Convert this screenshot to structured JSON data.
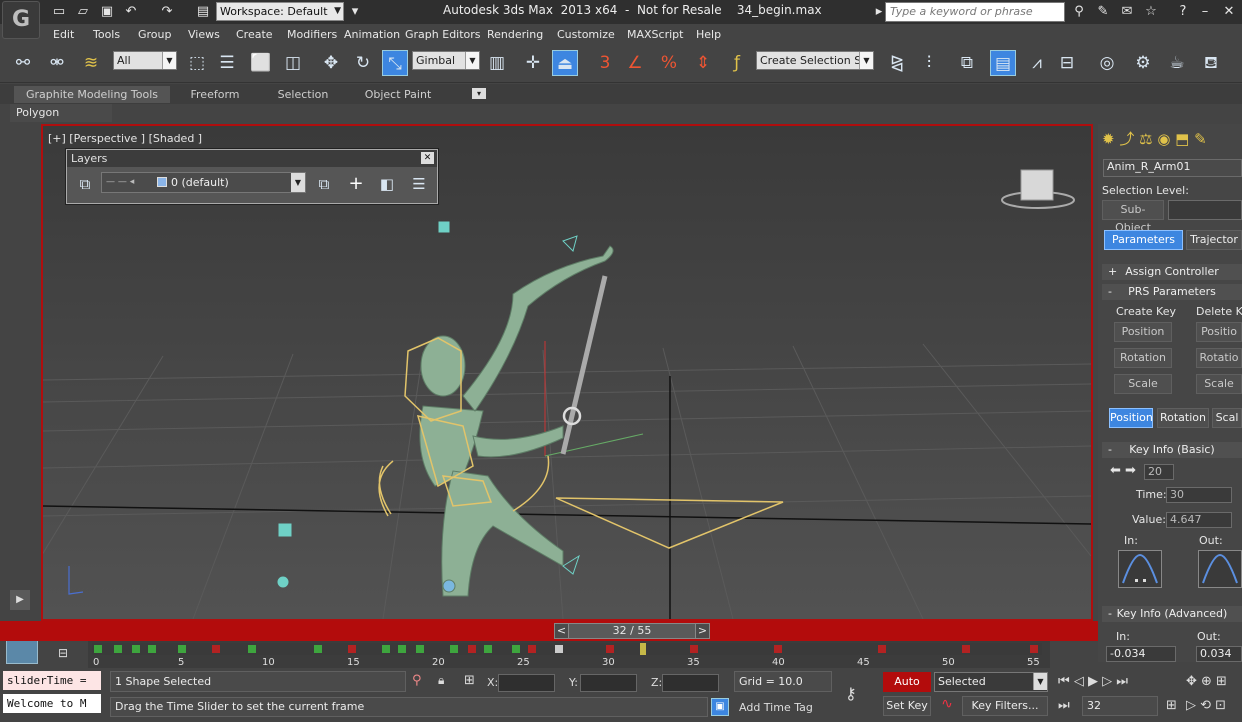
{
  "app": {
    "logo_text": "G",
    "workspace": "Workspace: Default",
    "title": "Autodesk 3ds Max  2013 x64  -  Not for Resale    34_begin.max",
    "search_placeholder": "Type a keyword or phrase"
  },
  "menu": [
    "Edit",
    "Tools",
    "Group",
    "Views",
    "Create",
    "Modifiers",
    "Animation",
    "Graph Editors",
    "Rendering",
    "Customize",
    "MAXScript",
    "Help"
  ],
  "toolbar": {
    "filter_value": "All",
    "coord_value": "Gimbal",
    "snap_label": "3",
    "angle_label": "%",
    "selset_value": "Create Selection Se"
  },
  "ribbon": {
    "tabs": [
      "Graphite Modeling Tools",
      "Freeform",
      "Selection",
      "Object Paint"
    ],
    "panel": "Polygon Modeling"
  },
  "viewport": {
    "label": "[+] [Perspective ] [Shaded ]"
  },
  "layers": {
    "title": "Layers",
    "current": "0 (default)"
  },
  "timeline": {
    "slider_text": "32 / 55",
    "ticks": [
      "0",
      "5",
      "10",
      "15",
      "20",
      "25",
      "30",
      "35",
      "40",
      "45",
      "50",
      "55"
    ]
  },
  "status": {
    "script1": "sliderTime =",
    "script2": "Welcome to M",
    "selection": "1 Shape Selected",
    "x_label": "X:",
    "y_label": "Y:",
    "z_label": "Z:",
    "grid": "Grid = 10.0",
    "prompt": "Drag the Time Slider to set the current frame",
    "add_time_tag": "Add Time Tag",
    "auto_key": "Auto Key",
    "selected": "Selected",
    "set_key": "Set Key",
    "key_filters": "Key Filters...",
    "frame": "32"
  },
  "command_panel": {
    "object_name": "Anim_R_Arm01",
    "selection_level": "Selection Level:",
    "sub_object": "Sub-Object",
    "tab_params": "Parameters",
    "tab_traj": "Trajector",
    "assign_controller": "Assign Controller",
    "prs": "PRS Parameters",
    "create_key": "Create Key",
    "delete_key": "Delete Ke",
    "position": "Position",
    "rotation": "Rotation",
    "scale": "Scale",
    "position_r": "Positio",
    "rotation_r": "Rotatio",
    "scale_r": "Scale",
    "tab_position": "Position",
    "tab_rotation": "Rotation",
    "tab_scale": "Scal",
    "key_info_basic": "Key Info (Basic)",
    "key_index": "20",
    "time_label": "Time:",
    "time_value": "30",
    "value_label": "Value:",
    "value_value": "4.647",
    "in_label": "In:",
    "out_label": "Out:",
    "key_info_adv": "Key Info (Advanced)",
    "adv_in_label": "In:",
    "adv_out_label": "Out:",
    "adv_in_value": "-0.034",
    "adv_out_value": "0.034"
  },
  "colors": {
    "accent_red": "#b30c0c",
    "accent_blue": "#3d86e0",
    "rig_yellow": "#e2c46a",
    "mesh_green": "#8db095"
  }
}
